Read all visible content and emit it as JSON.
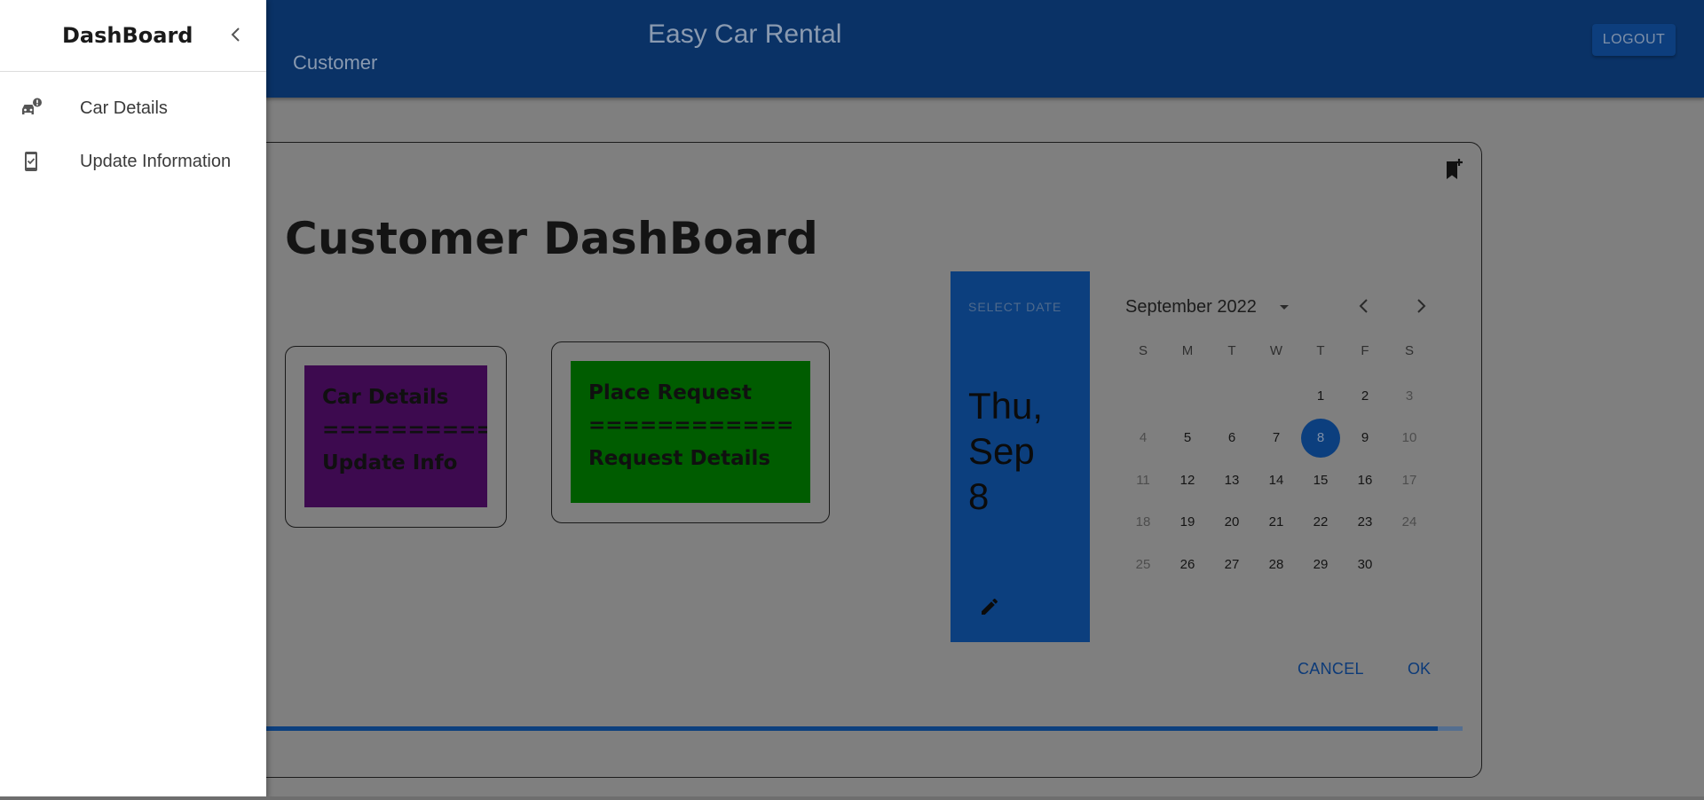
{
  "appbar": {
    "title": "Easy Car Rental",
    "subtitle": "Customer",
    "logout_label": "LOGOUT",
    "color": "#0a3266"
  },
  "main": {
    "page_title": "Customer DashBoard",
    "tiles": [
      {
        "lines": [
          "Car Details",
          "============",
          "Update Info"
        ],
        "color": "#3d0a4f"
      },
      {
        "lines": [
          "Place Request",
          "============",
          "Request Details"
        ],
        "color": "#005c00"
      }
    ],
    "progress_percent": 98
  },
  "datepicker": {
    "toolbar_label": "SELECT DATE",
    "selected_display": [
      "Thu,",
      "Sep",
      "8"
    ],
    "month_label": "September 2022",
    "weekdays": [
      "S",
      "M",
      "T",
      "W",
      "T",
      "F",
      "S"
    ],
    "weeks": [
      [
        "",
        "",
        "",
        "",
        "1",
        "2",
        "3"
      ],
      [
        "4",
        "5",
        "6",
        "7",
        "8",
        "9",
        "10"
      ],
      [
        "11",
        "12",
        "13",
        "14",
        "15",
        "16",
        "17"
      ],
      [
        "18",
        "19",
        "20",
        "21",
        "22",
        "23",
        "24"
      ],
      [
        "25",
        "26",
        "27",
        "28",
        "29",
        "30",
        ""
      ]
    ],
    "selected_day": "8",
    "disabled_days": [
      "3",
      "4",
      "10",
      "11",
      "17",
      "18",
      "24",
      "25"
    ],
    "cancel_label": "CANCEL",
    "ok_label": "OK",
    "accent": "#0c3f7e"
  },
  "drawer": {
    "title": "DashBoard",
    "items": [
      {
        "label": "Car Details",
        "icon": "car-alert-icon"
      },
      {
        "label": "Update Information",
        "icon": "phone-check-icon"
      }
    ]
  }
}
